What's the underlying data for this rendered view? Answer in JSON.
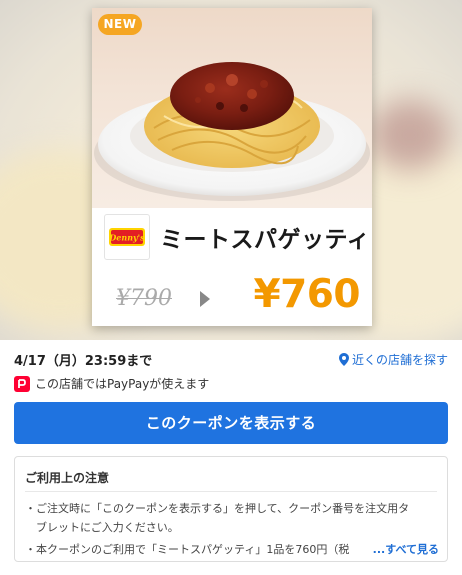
{
  "coupon": {
    "badge": "NEW",
    "brand_logo_text": "Denny's",
    "item_name": "ミートスパゲッティ",
    "old_price": "¥790",
    "new_price": "¥760"
  },
  "info": {
    "deadline": "4/17（月）23:59まで",
    "nearby_link": "近くの店舗を探す",
    "paypay_text": "この店舗ではPayPayが使えます",
    "show_button": "このクーポンを表示する"
  },
  "notes": {
    "title": "ご利用上の注意",
    "lines": [
      "・ご注文時に「このクーポンを表示する」を押して、クーポン番号を注文用タ",
      "　ブレットにご入力ください。",
      "・本クーポンのご利用で「ミートスパゲッティ」1品を760円（税"
    ],
    "see_all": "...すべて見る"
  },
  "colors": {
    "accent_blue": "#1f73e0",
    "price_orange": "#f39800",
    "badge_orange": "#f5a623",
    "paypay_red": "#ff0033"
  },
  "icons": {
    "location": "map-pin-icon",
    "paypay": "paypay-icon",
    "arrow": "arrow-right-icon"
  }
}
